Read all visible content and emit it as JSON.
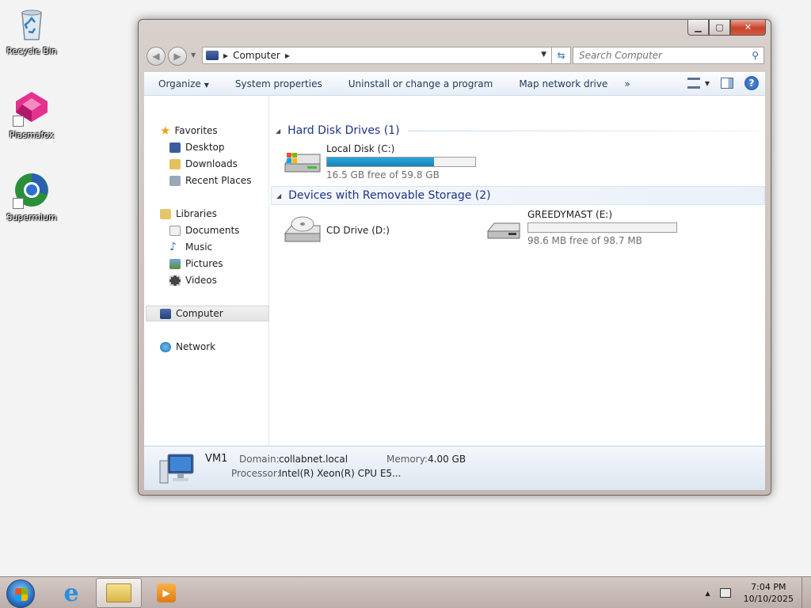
{
  "desktop": {
    "icons": [
      {
        "label": "Recycle Bin"
      },
      {
        "label": "Plasmafox"
      },
      {
        "label": "Supermium"
      }
    ]
  },
  "window": {
    "caption": {
      "minimize": "▁",
      "maximize": "▢",
      "close": "✕"
    },
    "address": {
      "crumb": "Computer"
    },
    "search": {
      "placeholder": "Search Computer"
    },
    "commands": {
      "organize": "Organize",
      "system_properties": "System properties",
      "uninstall": "Uninstall or change a program",
      "map_drive": "Map network drive",
      "more": "»"
    },
    "nav": {
      "favorites": "Favorites",
      "desktop": "Desktop",
      "downloads": "Downloads",
      "recent_places": "Recent Places",
      "libraries": "Libraries",
      "documents": "Documents",
      "music": "Music",
      "pictures": "Pictures",
      "videos": "Videos",
      "computer": "Computer",
      "network": "Network"
    },
    "groups": {
      "hdd": "Hard Disk Drives (1)",
      "removable": "Devices with Removable Storage (2)"
    },
    "drives": {
      "c": {
        "name": "Local Disk (C:)",
        "free": "16.5 GB free of 59.8 GB",
        "used_fraction": 0.72
      },
      "d": {
        "name": "CD Drive (D:)"
      },
      "e": {
        "name": "GREEDYMAST (E:)",
        "free": "98.6 MB free of 98.7 MB",
        "used_fraction": 0.001
      }
    },
    "details": {
      "name": "VM1",
      "domain_label": "Domain:",
      "domain_value": "collabnet.local",
      "memory_label": "Memory:",
      "memory_value": "4.00 GB",
      "processor_label": "Processor:",
      "processor_value": "Intel(R) Xeon(R) CPU E5..."
    }
  },
  "taskbar": {
    "time": "7:04 PM",
    "date": "10/10/2025"
  },
  "colors": {
    "accent": "#1e3287",
    "progress": "#27a6d8"
  }
}
